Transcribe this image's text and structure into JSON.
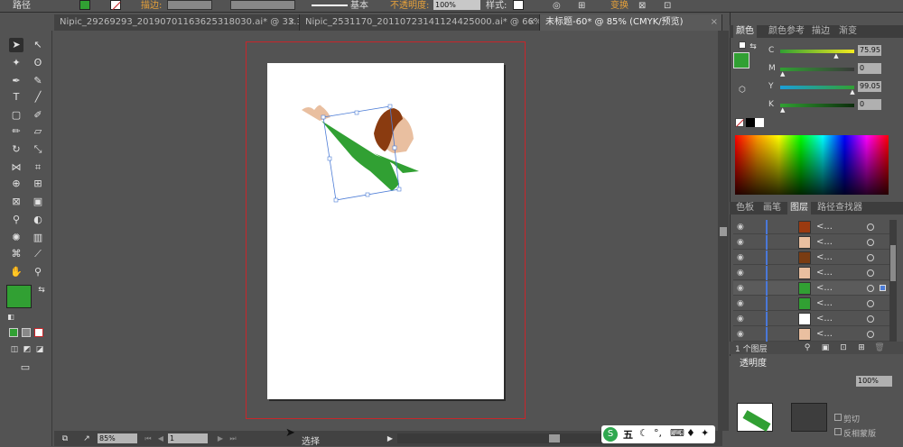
{
  "control_bar": {
    "object_type": "路径",
    "stroke_label": "描边:",
    "stroke_profile": "基本",
    "opacity_label": "不透明度:",
    "opacity_value": "100%",
    "style_label": "样式:",
    "transform_label": "变换",
    "fill_color": "#31a033"
  },
  "tabs": [
    {
      "label": "Nipic_29269293_20190701163625318030.ai* @ 33.3..."
    },
    {
      "label": "Nipic_2531170_20110723141124425000.ai* @ 66% (..."
    },
    {
      "label": "未标题-60* @ 85% (CMYK/预览)"
    }
  ],
  "status_bar": {
    "zoom": "85%",
    "artboard": "1",
    "status_text": "选择"
  },
  "color_panel": {
    "tabs": [
      "颜色",
      "颜色参考",
      "描边",
      "渐变"
    ],
    "channels": [
      {
        "name": "C",
        "value": "75.95",
        "fraction": 0.76,
        "gradient": "linear-gradient(90deg,#31a033,#f3ea20)"
      },
      {
        "name": "M",
        "value": "0",
        "fraction": 0.0,
        "gradient": "linear-gradient(90deg,#31a033,#393939)"
      },
      {
        "name": "Y",
        "value": "99.05",
        "fraction": 0.99,
        "gradient": "linear-gradient(90deg,#1c9fd8,#31a033)"
      },
      {
        "name": "K",
        "value": "0",
        "fraction": 0.0,
        "gradient": "linear-gradient(90deg,#31a033,#0c2c0c)"
      }
    ],
    "fill_color": "#31a033"
  },
  "layers_panel": {
    "tabs": [
      "色板",
      "画笔",
      "图层",
      "路径查找器"
    ],
    "rows": [
      {
        "name": "<...",
        "thumb": "#9b3a10"
      },
      {
        "name": "<...",
        "thumb": "#e9bfa0"
      },
      {
        "name": "<...",
        "thumb": "#7a3c12"
      },
      {
        "name": "<...",
        "thumb": "#e9bfa0"
      },
      {
        "name": "<...",
        "thumb": "#31a033"
      },
      {
        "name": "<...",
        "thumb": "#31a033"
      },
      {
        "name": "<...",
        "thumb": "#ffffff"
      },
      {
        "name": "<...",
        "thumb": "#e9bfa0"
      }
    ],
    "layer_count": "1 个图层"
  },
  "transparency_panel": {
    "title": "透明度",
    "value": "100%",
    "options": [
      "剪切",
      "反相蒙版"
    ]
  },
  "ime_bar": {
    "mode": "五"
  }
}
